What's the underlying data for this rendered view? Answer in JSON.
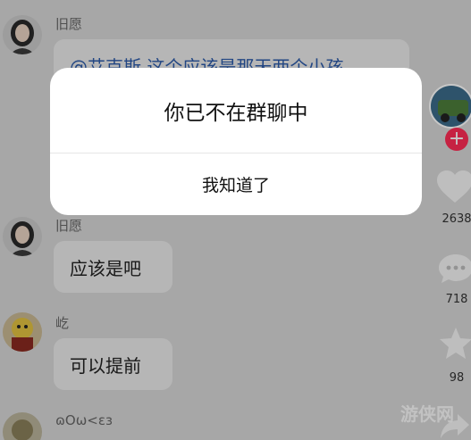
{
  "messages": [
    {
      "sender": "旧愿",
      "text": "@艾克斯 这个应该是那天两个小孩"
    },
    {
      "sender": "旧愿",
      "text": "应该是吧"
    },
    {
      "sender": "屹",
      "text": "可以提前"
    },
    {
      "sender": "ɷOω<ɛɜ",
      "text": ""
    }
  ],
  "rail": {
    "like_count": "2638",
    "comment_count": "718",
    "favorite_count": "98"
  },
  "dialog": {
    "title": "你已不在群聊中",
    "button": "我知道了"
  },
  "watermark": "游侠网",
  "colors": {
    "follow": "#fe2c55",
    "mention": "#2c5aa8"
  }
}
